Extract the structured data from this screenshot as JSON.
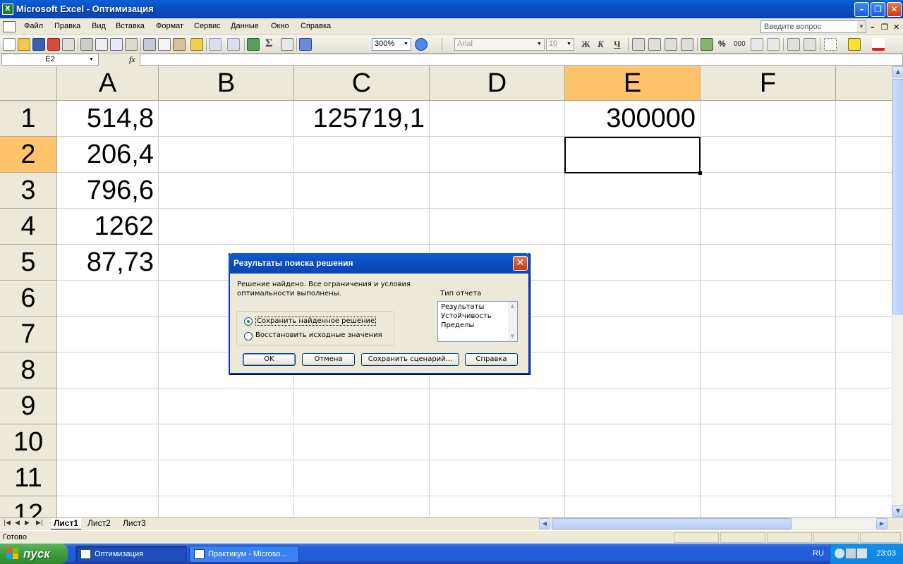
{
  "window": {
    "title": "Microsoft Excel - Оптимизация",
    "controls": [
      "minimize",
      "maximize",
      "close"
    ]
  },
  "menu": {
    "items": [
      "Файл",
      "Правка",
      "Вид",
      "Вставка",
      "Формат",
      "Сервис",
      "Данные",
      "Окно",
      "Справка"
    ],
    "help_placeholder": "Введите вопрос"
  },
  "toolbar": {
    "zoom": "300%",
    "font": "Arial",
    "font_size": "10",
    "bold_label": "Ж",
    "italic_label": "К",
    "underline_label": "Ч",
    "percent_label": "%",
    "thousands_label": "000",
    "sum_label": "Σ"
  },
  "formula_bar": {
    "name_box": "E2",
    "fx_label": "fx",
    "formula": ""
  },
  "sheet": {
    "columns": [
      "A",
      "B",
      "C",
      "D",
      "E",
      "F"
    ],
    "active_column": "E",
    "rows": [
      "1",
      "2",
      "3",
      "4",
      "5",
      "6",
      "7",
      "8",
      "9",
      "10",
      "11",
      "12"
    ],
    "active_row": "2",
    "cells": {
      "A1": "514,8",
      "A2": "206,4",
      "A3": "796,6",
      "A4": "1262",
      "A5": "87,73",
      "C1": "125719,1",
      "E1": "300000"
    }
  },
  "tabs": {
    "sheets": [
      "Лист1",
      "Лист2",
      "Лист3"
    ],
    "active": "Лист1"
  },
  "status": {
    "text": "Готово"
  },
  "taskbar": {
    "start_label": "пуск",
    "tasks": [
      "Оптимизация",
      "Практикум - Microso..."
    ],
    "language": "RU",
    "clock": "23:03"
  },
  "dialog": {
    "title": "Результаты поиска решения",
    "message": "Решение найдено. Все ограничения и условия оптимальности выполнены.",
    "report_type_label": "Тип отчета",
    "reports": [
      "Результаты",
      "Устойчивость",
      "Пределы"
    ],
    "options": [
      {
        "label": "Сохранить найденное решение",
        "checked": true
      },
      {
        "label": "Восстановить исходные значения",
        "checked": false
      }
    ],
    "buttons": {
      "ok": "OK",
      "cancel": "Отмена",
      "save_scenario": "Сохранить сценарий...",
      "help": "Справка"
    }
  }
}
